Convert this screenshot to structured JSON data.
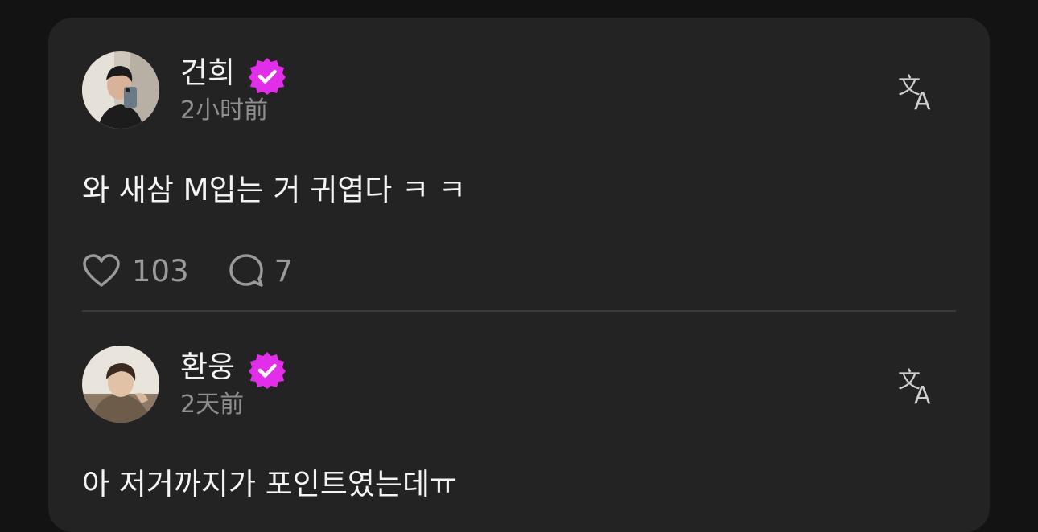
{
  "colors": {
    "background": "#131313",
    "card": "#232323",
    "verified_badge": "#e22ee8",
    "text_primary": "#f2f2f2",
    "text_secondary": "#8e8e8e"
  },
  "posts": [
    {
      "username": "건희",
      "verified": true,
      "time": "2小时前",
      "content": "와 새삼 M입는 거 귀엽다 ㅋ ㅋ",
      "likes": "103",
      "comments": "7",
      "icons": {
        "like": "heart-icon",
        "comment": "comment-bubble-icon",
        "translate": "translate-icon",
        "badge": "verified-badge-icon"
      }
    },
    {
      "username": "환웅",
      "verified": true,
      "time": "2天前",
      "content": "아 저거까지가 포인트였는데ㅠ",
      "icons": {
        "translate": "translate-icon",
        "badge": "verified-badge-icon"
      }
    }
  ]
}
